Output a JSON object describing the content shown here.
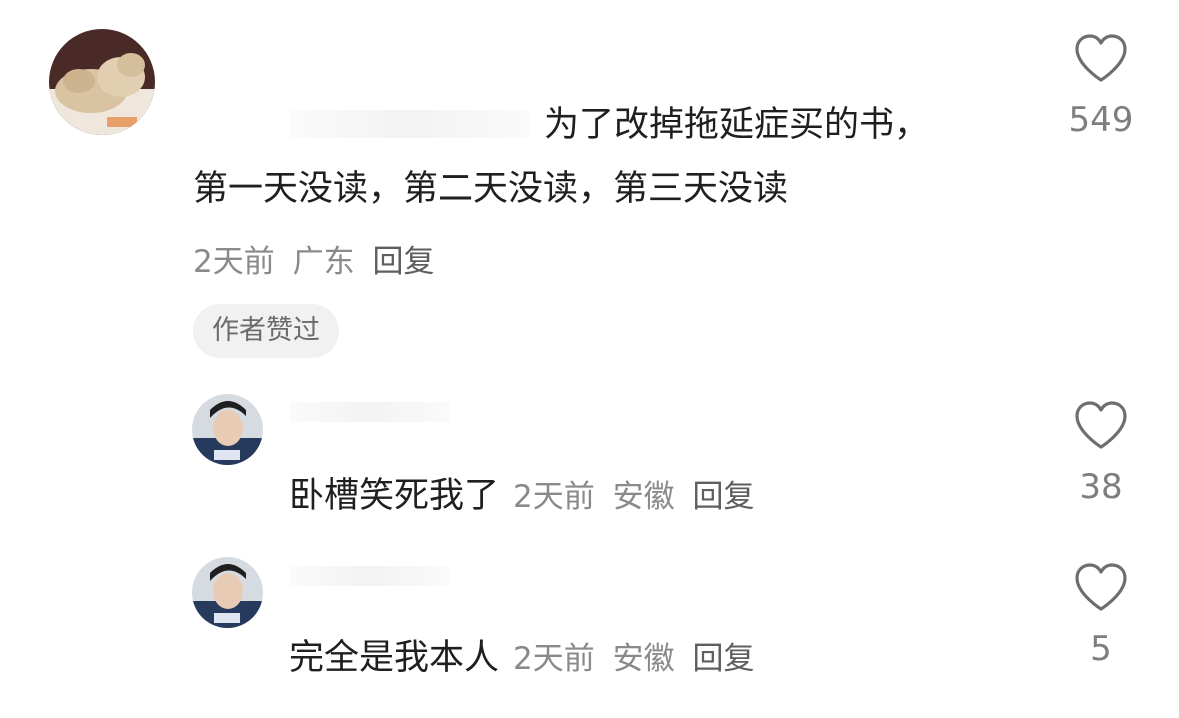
{
  "main_comment": {
    "text_line1": "为了改掉拖延症买的书，",
    "text_line2": "第一天没读，第二天没读，第三天没读",
    "time": "2天前",
    "location": "广东",
    "reply_label": "回复",
    "badge": "作者赞过",
    "likes": "549"
  },
  "replies": [
    {
      "text": "卧槽笑死我了",
      "time": "2天前",
      "location": "安徽",
      "reply_label": "回复",
      "likes": "38"
    },
    {
      "text": "完全是我本人",
      "time": "2天前",
      "location": "安徽",
      "reply_label": "回复",
      "likes": "5"
    }
  ],
  "icons": {
    "like": "heart-outline-icon"
  },
  "colors": {
    "text": "#1f1f1f",
    "meta": "#8a8a8a",
    "badge_bg": "#f1f1f1"
  }
}
